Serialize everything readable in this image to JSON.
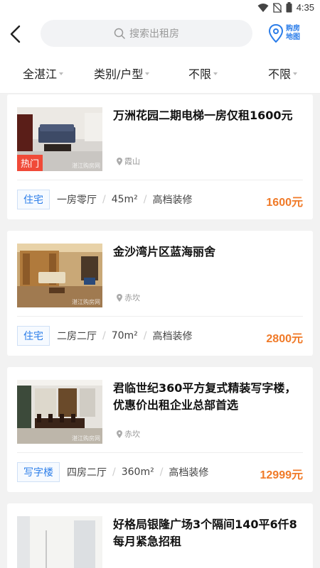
{
  "status_bar": {
    "time": "4:35"
  },
  "header": {
    "search_placeholder": "搜索出租房",
    "map_label_line1": "购房",
    "map_label_line2": "地图"
  },
  "filters": [
    "全湛江",
    "类别/户型",
    "不限",
    "不限"
  ],
  "listings": [
    {
      "title": "万洲花园二期电梯一房仅租1600元",
      "location": "霞山",
      "hot_badge": "热门",
      "watermark": "湛江购房网",
      "type": "住宅",
      "layout": "一房零厅",
      "area": "45m²",
      "decor": "高档装修",
      "price": "1600元"
    },
    {
      "title": "金沙湾片区蓝海丽舍",
      "location": "赤坎",
      "watermark": "湛江购房网",
      "type": "住宅",
      "layout": "二房二厅",
      "area": "70m²",
      "decor": "高档装修",
      "price": "2800元"
    },
    {
      "title": "君临世纪360平方复式精装写字楼，优惠价出租企业总部首选",
      "location": "赤坎",
      "watermark": "湛江购房网",
      "type": "写字楼",
      "layout": "四房二厅",
      "area": "360m²",
      "decor": "高档装修",
      "price": "12999元"
    },
    {
      "title": "好格局银隆广场3个隔间140平6仟8每月紧急招租"
    }
  ],
  "colors": {
    "accent_blue": "#2b7de9",
    "price_orange": "#f07a28",
    "hot_red": "#f04a38"
  }
}
